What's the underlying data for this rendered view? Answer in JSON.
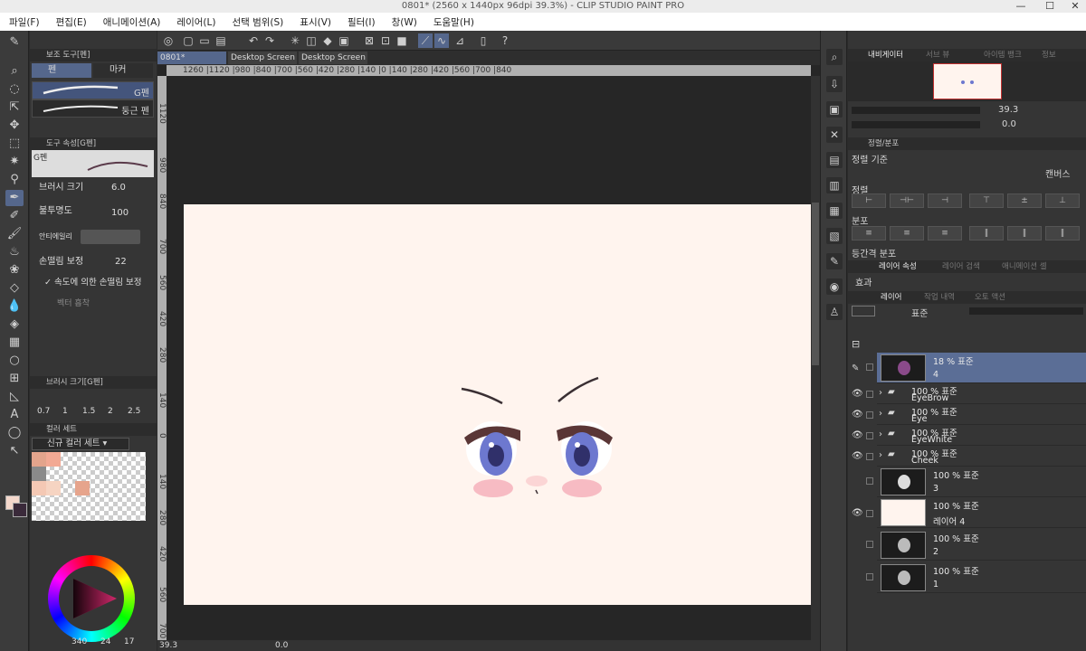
{
  "window": {
    "title": "0801* (2560 x 1440px 96dpi 39.3%)  - CLIP STUDIO PAINT PRO",
    "min": "—",
    "max": "☐",
    "close": "✕"
  },
  "menu": [
    "파일(F)",
    "편집(E)",
    "애니메이션(A)",
    "레이어(L)",
    "선택 범위(S)",
    "표시(V)",
    "필터(I)",
    "창(W)",
    "도움말(H)"
  ],
  "tabs": [
    "0801*",
    "Desktop Screen",
    "Desktop Screen"
  ],
  "ruler_h": "1260 |1120 |980 |840 |700 |560 |420 |280 |140 |0 |140 |280 |420 |560 |700 |840",
  "ruler_v": [
    "1120",
    "980",
    "840",
    "700",
    "560",
    "420",
    "280",
    "140",
    "0",
    "140",
    "280",
    "420",
    "560",
    "700"
  ],
  "subtool": {
    "panel": "보조 도구[펜]",
    "tab_pen": "펜",
    "tab_marker": "마커",
    "brush1": "G펜",
    "brush2": "둥근 펜"
  },
  "toolprop": {
    "panel": "도구 속성[G펜]",
    "preview": "G펜",
    "brush_size_label": "브러시 크기",
    "brush_size": "6.0",
    "opacity_label": "불투명도",
    "opacity": "100",
    "aa_label": "안티에일리",
    "stab_label": "손떨림 보정",
    "stab": "22",
    "speed_label": "속도에 의한 손떨림 보정",
    "vector_label": "벡터 흡착"
  },
  "brushsize": {
    "panel": "브러시 크기[G펜]",
    "sizes": [
      "0.7",
      "1",
      "1.5",
      "2",
      "2.5"
    ]
  },
  "colorset": {
    "panel": "컬러 세트",
    "dropdown": "신규 컬러 세트"
  },
  "colorwheel": {
    "h": "340",
    "s": "24",
    "v": "17"
  },
  "statusbar": {
    "zoom": "39.3",
    "angle": "0.0"
  },
  "navigator": {
    "tab1": "내비게이터",
    "tab2": "서브 뷰",
    "tab3": "아이템 뱅크",
    "tab4": "정보",
    "zoom": "39.3",
    "angle": "0.0"
  },
  "align": {
    "panel": "정렬/분포",
    "basis_label": "정렬 기준",
    "basis_value": "캔버스",
    "align_label": "정렬",
    "dist_label": "분포",
    "equal_label": "등간격 분포"
  },
  "layerprop": {
    "tab1": "레이어 속성",
    "tab2": "레이어 검색",
    "tab3": "애니메이션 셀",
    "effect_label": "효과"
  },
  "layers": {
    "tab1": "레이어",
    "tab2": "작업 내역",
    "tab3": "오토 액션",
    "blend": "표준",
    "items": [
      {
        "pct": "18 % 표준",
        "name": "4",
        "type": "big"
      },
      {
        "pct": "100 % 표준",
        "name": "EyeBrow",
        "type": "folder"
      },
      {
        "pct": "100 % 표준",
        "name": "Eye",
        "type": "folder"
      },
      {
        "pct": "100 % 표준",
        "name": "EyeWhite",
        "type": "folder"
      },
      {
        "pct": "100 % 표준",
        "name": "Cheek",
        "type": "folder"
      },
      {
        "pct": "100 % 표준",
        "name": "3",
        "type": "big"
      },
      {
        "pct": "100 % 표준",
        "name": "레이어 4",
        "type": "big"
      },
      {
        "pct": "100 % 표준",
        "name": "2",
        "type": "big"
      },
      {
        "pct": "100 % 표준",
        "name": "1",
        "type": "big"
      }
    ]
  },
  "colors": {
    "paper": "#fff4ee",
    "accent": "#55678c",
    "iris": "#7c85d6",
    "blush": "#f4a8b4"
  }
}
